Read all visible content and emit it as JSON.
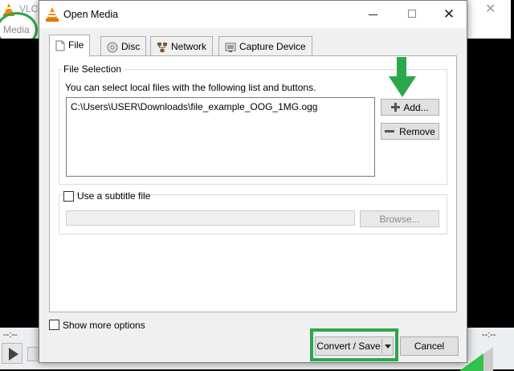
{
  "background_app": {
    "title": "VLC",
    "menu_media": "Media",
    "time_left": "--:--",
    "time_right": "--:--"
  },
  "dialog": {
    "title": "Open Media",
    "tabs": [
      {
        "label": "File",
        "icon": "file-icon",
        "active": true
      },
      {
        "label": "Disc",
        "icon": "disc-icon",
        "active": false
      },
      {
        "label": "Network",
        "icon": "network-icon",
        "active": false
      },
      {
        "label": "Capture Device",
        "icon": "capture-device-icon",
        "active": false
      }
    ],
    "file_selection": {
      "title": "File Selection",
      "description": "You can select local files with the following list and buttons.",
      "files": [
        "C:\\Users\\USER\\Downloads\\file_example_OOG_1MG.ogg"
      ],
      "add_label": "Add...",
      "remove_label": "Remove"
    },
    "subtitle": {
      "label": "Use a subtitle file",
      "checked": false,
      "path_value": "",
      "browse_label": "Browse..."
    },
    "show_more_label": "Show more options",
    "convert_save_label": "Convert / Save",
    "cancel_label": "Cancel"
  },
  "colors": {
    "annotation_green": "#2aa84a",
    "vlc_orange": "#f08c00"
  }
}
